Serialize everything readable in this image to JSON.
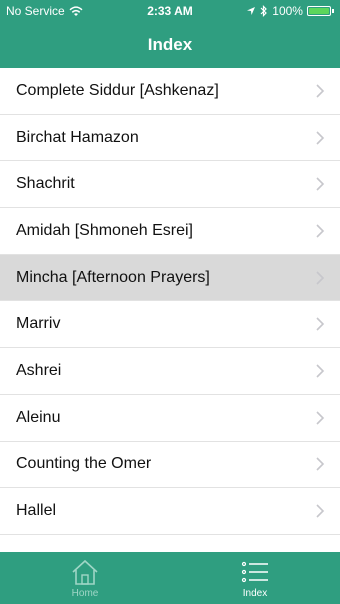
{
  "status_bar": {
    "carrier": "No Service",
    "time": "2:33 AM",
    "battery": "100%"
  },
  "nav": {
    "title": "Index"
  },
  "list": {
    "items": [
      {
        "label": "Complete Siddur [Ashkenaz]"
      },
      {
        "label": "Birchat Hamazon"
      },
      {
        "label": "Shachrit"
      },
      {
        "label": "Amidah [Shmoneh Esrei]"
      },
      {
        "label": "Mincha [Afternoon Prayers]"
      },
      {
        "label": "Marriv"
      },
      {
        "label": "Ashrei"
      },
      {
        "label": "Aleinu"
      },
      {
        "label": "Counting the Omer"
      },
      {
        "label": "Hallel"
      }
    ]
  },
  "tabbar": {
    "home_label": "Home",
    "index_label": "Index"
  },
  "colors": {
    "accent": "#2f9e80",
    "selected_row": "#d9d9d9"
  }
}
